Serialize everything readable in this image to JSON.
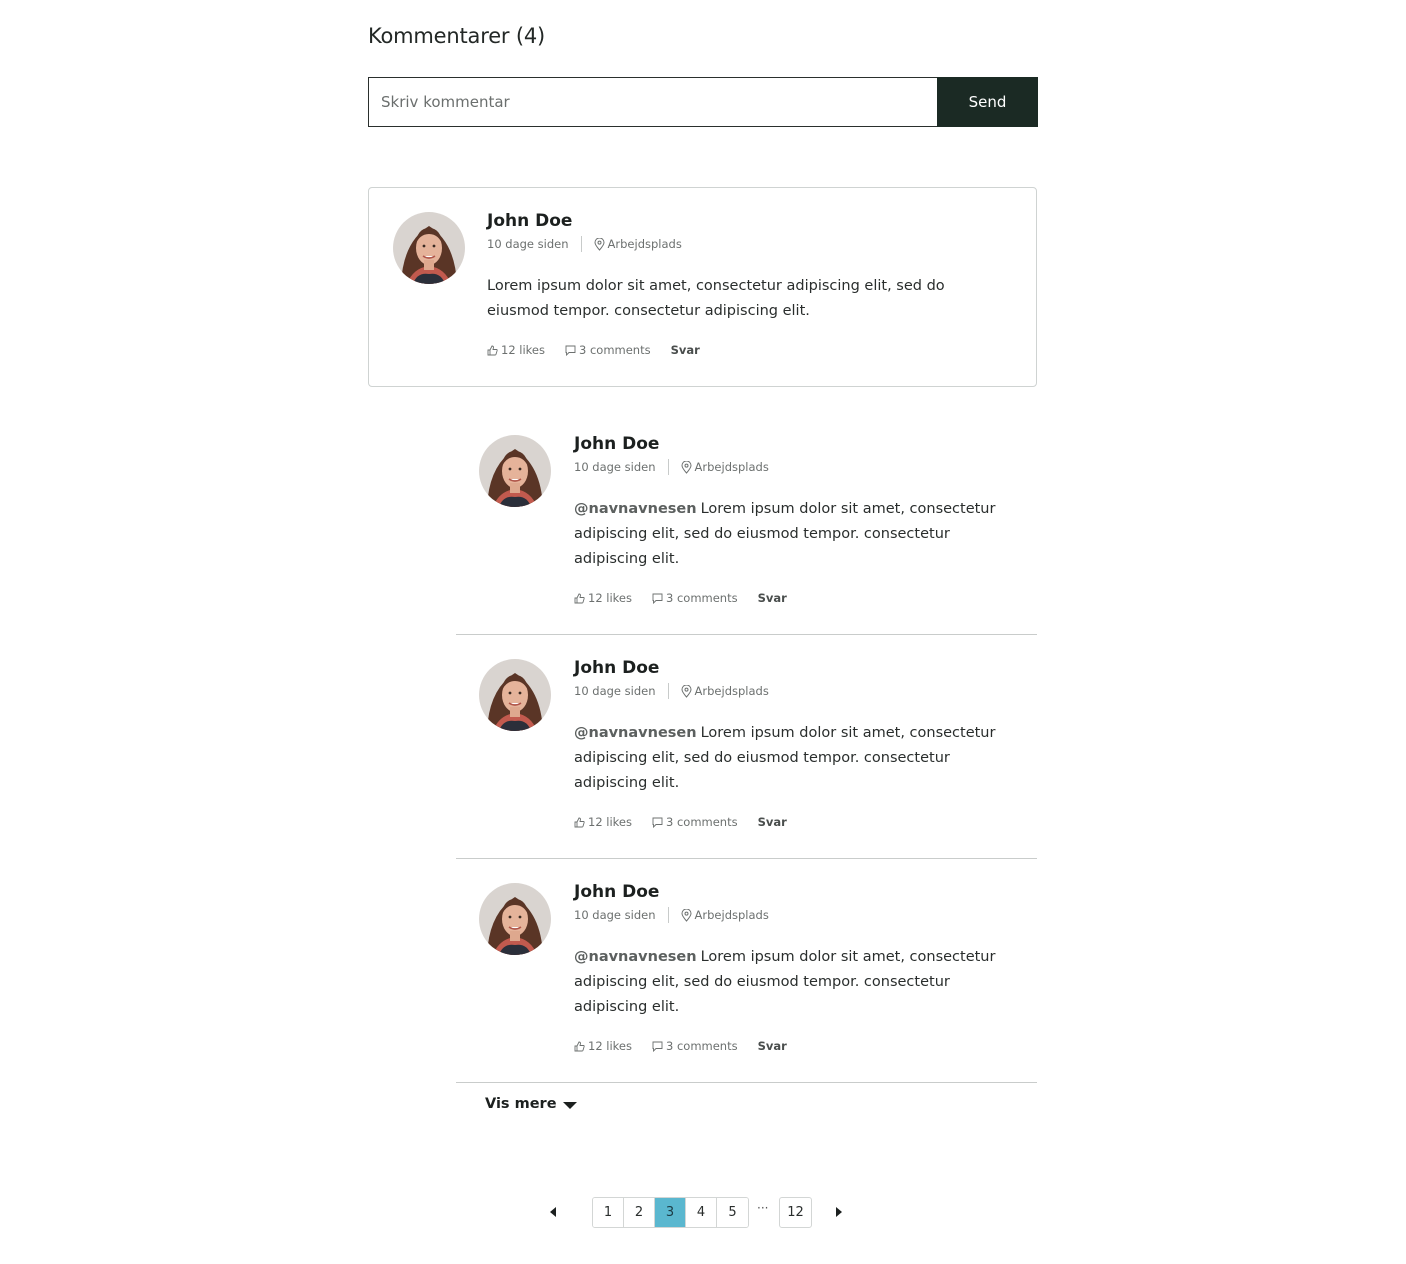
{
  "section": {
    "title": "Kommentarer",
    "count": "4"
  },
  "form": {
    "placeholder": "Skriv kommentar",
    "send_label": "Send"
  },
  "comments": [
    {
      "name": "John Doe",
      "time": "10 dage siden",
      "location": "Arbejdsplads",
      "mention": "",
      "text": "Lorem ipsum dolor sit amet, consectetur adipiscing elit, sed do eiusmod tempor. consectetur adipiscing elit.",
      "likes": "12 likes",
      "comments": "3 comments",
      "reply_label": "Svar"
    },
    {
      "name": "John Doe",
      "time": "10 dage siden",
      "location": "Arbejdsplads",
      "mention": "@navnavnesen",
      "text": "Lorem ipsum dolor sit amet, consectetur adipiscing elit, sed do eiusmod tempor. consectetur adipiscing elit.",
      "likes": "12 likes",
      "comments": "3 comments",
      "reply_label": "Svar"
    },
    {
      "name": "John Doe",
      "time": "10 dage siden",
      "location": "Arbejdsplads",
      "mention": "@navnavnesen",
      "text": "Lorem ipsum dolor sit amet, consectetur adipiscing elit, sed do eiusmod tempor. consectetur adipiscing elit.",
      "likes": "12 likes",
      "comments": "3 comments",
      "reply_label": "Svar"
    },
    {
      "name": "John Doe",
      "time": "10 dage siden",
      "location": "Arbejdsplads",
      "mention": "@navnavnesen",
      "text": "Lorem ipsum dolor sit amet, consectetur adipiscing elit, sed do eiusmod tempor. consectetur adipiscing elit.",
      "likes": "12 likes",
      "comments": "3 comments",
      "reply_label": "Svar"
    }
  ],
  "show_more": {
    "label": "Vis mere",
    "icon": "caret-down-icon"
  },
  "pagination": {
    "pages": [
      "1",
      "2",
      "3",
      "4",
      "5"
    ],
    "current": "3",
    "ellipsis": "···",
    "last": "12",
    "prev_icon": "caret-left-icon",
    "next_icon": "caret-right-icon"
  },
  "colors": {
    "send_button": "#1b2a24",
    "active_page": "#5ab7cf",
    "border": "#cfd3d2"
  }
}
